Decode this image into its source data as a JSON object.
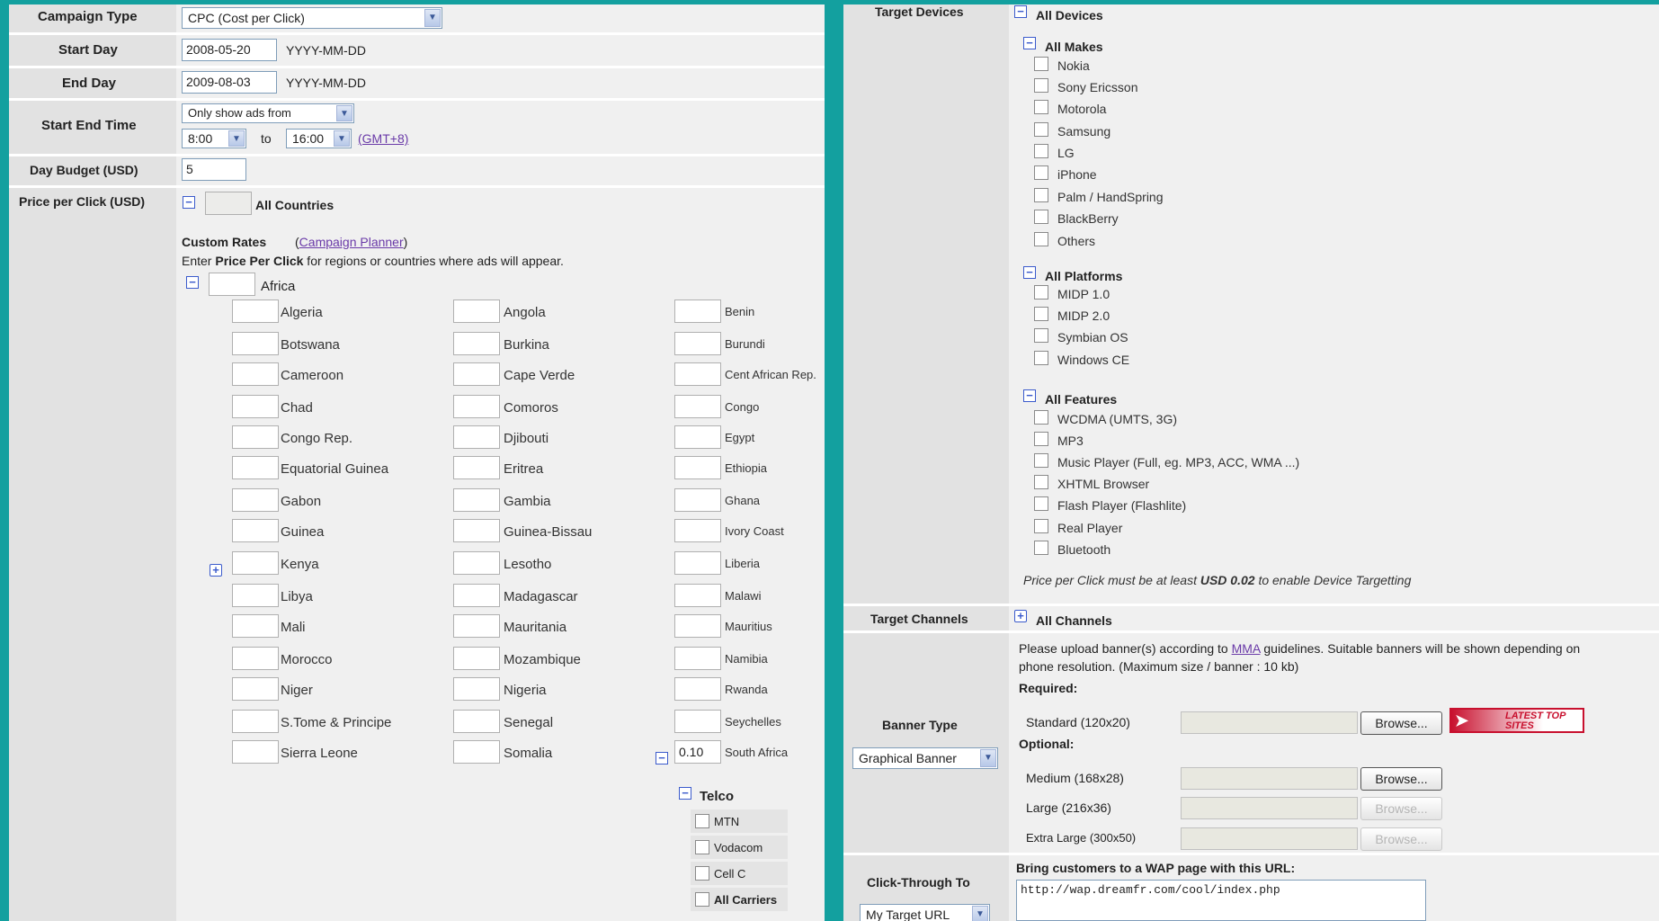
{
  "campaign": {
    "type_label": "Campaign Type",
    "type_value": "CPC (Cost per Click)",
    "start_label": "Start Day",
    "start_value": "2008-05-20",
    "date_fmt": "YYYY-MM-DD",
    "end_label": "End Day",
    "end_value": "2009-08-03",
    "time_label": "Start End Time",
    "time_mode": "Only show ads from",
    "time_from": "8:00",
    "time_to_word": "to",
    "time_to": "16:00",
    "timezone": "(GMT+8)",
    "budget_label": "Day Budget (USD)",
    "budget_value": "5",
    "ppc_label": "Price per Click (USD)",
    "all_countries": "All Countries",
    "custom_rates": "Custom Rates",
    "planner_open": "(",
    "planner": "Campaign Planner",
    "planner_close": ")",
    "hint_pre": "Enter ",
    "hint_bold": "Price Per Click",
    "hint_post": " for regions or countries where ads will appear.",
    "region": "Africa"
  },
  "countries": {
    "col1": [
      {
        "name": "Algeria",
        "value": ""
      },
      {
        "name": "Botswana",
        "value": ""
      },
      {
        "name": "Cameroon",
        "value": ""
      },
      {
        "name": "Chad",
        "value": ""
      },
      {
        "name": "Congo Rep.",
        "value": ""
      },
      {
        "name": "Equatorial Guinea",
        "value": ""
      },
      {
        "name": "Gabon",
        "value": ""
      },
      {
        "name": "Guinea",
        "value": ""
      },
      {
        "name": "Kenya",
        "value": ""
      },
      {
        "name": "Libya",
        "value": ""
      },
      {
        "name": "Mali",
        "value": ""
      },
      {
        "name": "Morocco",
        "value": ""
      },
      {
        "name": "Niger",
        "value": ""
      },
      {
        "name": "S.Tome & Principe",
        "value": ""
      },
      {
        "name": "Sierra Leone",
        "value": ""
      }
    ],
    "col2": [
      {
        "name": "Angola",
        "value": ""
      },
      {
        "name": "Burkina",
        "value": ""
      },
      {
        "name": "Cape Verde",
        "value": ""
      },
      {
        "name": "Comoros",
        "value": ""
      },
      {
        "name": "Djibouti",
        "value": ""
      },
      {
        "name": "Eritrea",
        "value": ""
      },
      {
        "name": "Gambia",
        "value": ""
      },
      {
        "name": "Guinea-Bissau",
        "value": ""
      },
      {
        "name": "Lesotho",
        "value": ""
      },
      {
        "name": "Madagascar",
        "value": ""
      },
      {
        "name": "Mauritania",
        "value": ""
      },
      {
        "name": "Mozambique",
        "value": ""
      },
      {
        "name": "Nigeria",
        "value": ""
      },
      {
        "name": "Senegal",
        "value": ""
      },
      {
        "name": "Somalia",
        "value": ""
      }
    ],
    "col3": [
      {
        "name": "Benin",
        "value": ""
      },
      {
        "name": "Burundi",
        "value": ""
      },
      {
        "name": "Cent African Rep.",
        "value": ""
      },
      {
        "name": "Congo",
        "value": ""
      },
      {
        "name": "Egypt",
        "value": ""
      },
      {
        "name": "Ethiopia",
        "value": ""
      },
      {
        "name": "Ghana",
        "value": ""
      },
      {
        "name": "Ivory Coast",
        "value": ""
      },
      {
        "name": "Liberia",
        "value": ""
      },
      {
        "name": "Malawi",
        "value": ""
      },
      {
        "name": "Mauritius",
        "value": ""
      },
      {
        "name": "Namibia",
        "value": ""
      },
      {
        "name": "Rwanda",
        "value": ""
      },
      {
        "name": "Seychelles",
        "value": ""
      },
      {
        "name": "South Africa",
        "value": "0.10"
      }
    ]
  },
  "telco": {
    "label": "Telco",
    "items": [
      "MTN",
      "Vodacom",
      "Cell C",
      "All Carriers"
    ]
  },
  "devices": {
    "label": "Target Devices",
    "all": "All Devices",
    "groups": [
      {
        "title": "All Makes",
        "items": [
          "Nokia",
          "Sony Ericsson",
          "Motorola",
          "Samsung",
          "LG",
          "iPhone",
          "Palm / HandSpring",
          "BlackBerry",
          "Others"
        ]
      },
      {
        "title": "All Platforms",
        "items": [
          "MIDP 1.0",
          "MIDP 2.0",
          "Symbian OS",
          "Windows CE"
        ]
      },
      {
        "title": "All Features",
        "items": [
          "WCDMA (UMTS, 3G)",
          "MP3",
          "Music Player (Full, eg. MP3, ACC, WMA ...)",
          "XHTML Browser",
          "Flash Player (Flashlite)",
          "Real Player",
          "Bluetooth"
        ]
      }
    ],
    "note_pre": "Price per Click must be at least ",
    "note_bold": "USD 0.02",
    "note_post": " to enable Device Targetting"
  },
  "channels": {
    "label": "Target Channels",
    "all": "All Channels"
  },
  "banner": {
    "label": "Banner Type",
    "type_value": "Graphical Banner",
    "intro_pre": "Please upload banner(s) according to ",
    "intro_link": "MMA",
    "intro_post": " guidelines. Suitable banners will be shown depending on",
    "intro_line2": "phone resolution. (Maximum size / banner : 10 kb)",
    "required": "Required:",
    "optional": "Optional:",
    "browse": "Browse...",
    "promo": "LATEST TOP SITES",
    "sizes": [
      {
        "name": "Standard (120x20)",
        "enabled": true
      },
      {
        "name": "Medium (168x28)",
        "enabled": true
      },
      {
        "name": "Large (216x36)",
        "enabled": false
      },
      {
        "name": "Extra Large (300x50)",
        "enabled": false
      }
    ]
  },
  "clickthrough": {
    "label": "Click-Through To",
    "heading": "Bring customers to a WAP page with this URL:",
    "url": "http://wap.dreamfr.com/cool/index.php",
    "select": "My Target URL"
  },
  "colors": {
    "teal": "#13a09f",
    "link": "#6a3aa8",
    "toggle": "#3b5bcc"
  }
}
